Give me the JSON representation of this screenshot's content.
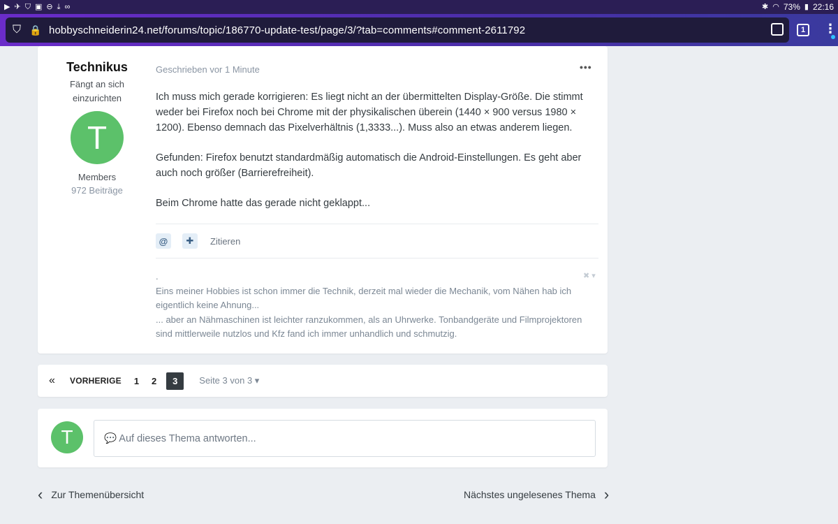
{
  "status_bar": {
    "left_icons": [
      "play-icon",
      "telegram-icon",
      "shield-icon",
      "image-icon",
      "minus-circle-icon",
      "download-icon",
      "infinity-icon"
    ],
    "battery": "73%",
    "time": "22:16"
  },
  "browser": {
    "url": "hobbyschneiderin24.net/forums/topic/186770-update-test/page/3/?tab=comments#comment-2611792",
    "tab_count": "1"
  },
  "post": {
    "author_name": "Technikus",
    "author_title": "Fängt an sich einzurichten",
    "avatar_letter": "T",
    "group": "Members",
    "post_count": "972 Beiträge",
    "meta": "Geschrieben vor 1 Minute",
    "more_label": "•••",
    "paragraphs": [
      "Ich muss mich gerade korrigieren: Es liegt nicht an der übermittelten Display-Größe. Die stimmt weder bei Firefox noch bei Chrome mit der physikalischen überein (1440 × 900 versus 1980 × 1200). Ebenso demnach das Pixelverhältnis (1,3333...). Muss also an etwas anderem liegen.",
      "Gefunden: Firefox benutzt standardmäßig automatisch die Android-Einstellungen. Es geht aber auch noch größer (Barrierefreiheit).",
      "Beim Chrome hatte das gerade nicht geklappt..."
    ],
    "actions": {
      "mention_label": "@",
      "multiquote_label": "✚",
      "quote_label": "Zitieren"
    },
    "signature": [
      ".",
      "Eins meiner Hobbies ist schon immer die Technik, derzeit mal wieder die Mechanik, vom Nähen hab ich eigentlich keine Ahnung...",
      "... aber an Nähmaschinen ist leichter ranzukommen, als an Uhrwerke. Tonbandgeräte und Filmprojektoren sind mittlerweile nutzlos und Kfz fand ich immer unhandlich und schmutzig."
    ]
  },
  "pagination": {
    "first_icon": "«",
    "prev_label": "VORHERIGE",
    "pages": [
      "1",
      "2",
      "3"
    ],
    "current_page": "3",
    "page_info": "Seite 3 von 3 ▾"
  },
  "reply": {
    "avatar_letter": "T",
    "placeholder": "💬 Auf dieses Thema antworten..."
  },
  "bottom_nav": {
    "back_label": "Zur Themenübersicht",
    "next_label": "Nächstes ungelesenes Thema"
  },
  "colors": {
    "avatar": "#5cc16a",
    "status_bar": "#2b1e55",
    "toolbar_start": "#6a2cc9",
    "page_bg": "#ebeef2"
  }
}
